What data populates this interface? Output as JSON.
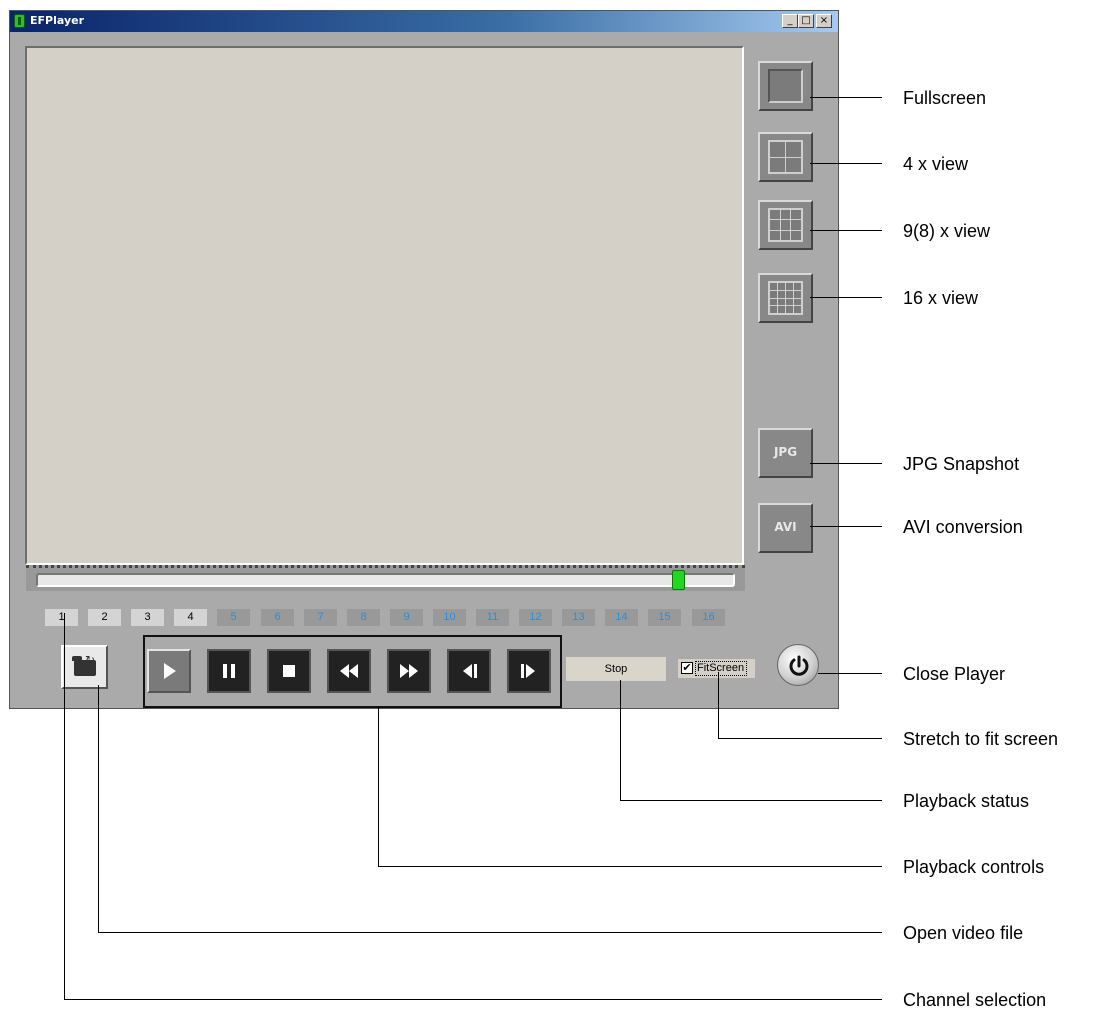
{
  "window": {
    "title": "EFPlayer",
    "minimize": "_",
    "maximize": "□",
    "close": "×"
  },
  "side_buttons": {
    "jpg_label": "JPG",
    "avi_label": "AVI"
  },
  "seek_position": 0.93,
  "channels": [
    {
      "label": "1",
      "active": true
    },
    {
      "label": "2",
      "active": true
    },
    {
      "label": "3",
      "active": true
    },
    {
      "label": "4",
      "active": true
    },
    {
      "label": "5",
      "active": false
    },
    {
      "label": "6",
      "active": false
    },
    {
      "label": "7",
      "active": false
    },
    {
      "label": "8",
      "active": false
    },
    {
      "label": "9",
      "active": false
    },
    {
      "label": "10",
      "active": false
    },
    {
      "label": "11",
      "active": false
    },
    {
      "label": "12",
      "active": false
    },
    {
      "label": "13",
      "active": false
    },
    {
      "label": "14",
      "active": false
    },
    {
      "label": "15",
      "active": false
    },
    {
      "label": "16",
      "active": false
    }
  ],
  "playback_controls": [
    {
      "icon": "play-icon"
    },
    {
      "icon": "pause-icon"
    },
    {
      "icon": "stop-icon"
    },
    {
      "icon": "rewind-icon"
    },
    {
      "icon": "fast-forward-icon"
    },
    {
      "icon": "step-back-icon"
    },
    {
      "icon": "step-forward-icon"
    }
  ],
  "status": {
    "text": "Stop"
  },
  "fit_screen": {
    "label": "FitScreen",
    "checked": true,
    "check_mark": "✔"
  },
  "callouts": {
    "fullscreen": "Fullscreen",
    "view4": "4 x view",
    "view9": "9(8) x view",
    "view16": "16 x view",
    "jpg": "JPG Snapshot",
    "avi": "AVI conversion",
    "close": "Close Player",
    "stretch": "Stretch to fit screen",
    "status": "Playback status",
    "controls": "Playback controls",
    "open": "Open video file",
    "channel": "Channel selection"
  },
  "colors": {
    "window_bg": "#aaaaaa",
    "video_bg": "#d4d0c8",
    "seek_thumb": "#22d622",
    "inactive_channel_text": "#2b8fd6"
  }
}
